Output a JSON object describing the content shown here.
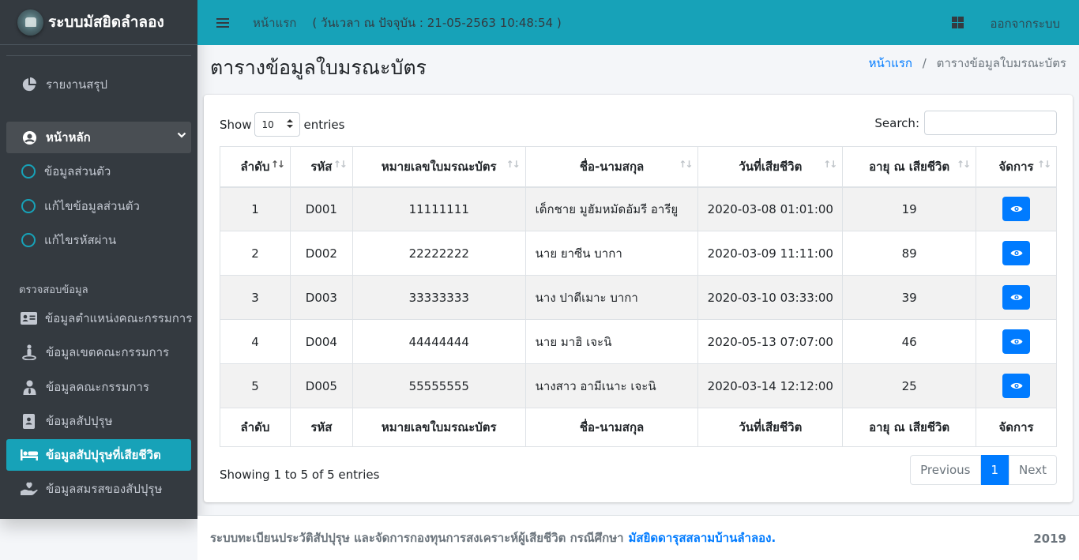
{
  "brand": {
    "name": "ระบบมัสยิดลำลอง",
    "logo_icon": "mosque-logo-icon"
  },
  "sidebar": {
    "report": "รายงานสรุป",
    "main_menu": "หน้าหลัก",
    "sub_items": [
      "ข้อมูลส่วนตัว",
      "แก้ไขข้อมูลส่วนตัว",
      "แก้ไขรหัสผ่าน"
    ],
    "section_header": "ตรวจสอบข้อมูล",
    "items": [
      {
        "label": "ข้อมูลตำแหน่งคณะกรรมการ",
        "icon": "id-card-icon"
      },
      {
        "label": "ข้อมูลเขตคณะกรรมการ",
        "icon": "street-view-icon"
      },
      {
        "label": "ข้อมูลคณะกรรมการ",
        "icon": "user-tie-icon"
      },
      {
        "label": "ข้อมูลสัปปุรุษ",
        "icon": "address-book-icon"
      },
      {
        "label": "ข้อมูลสัปปุรุษที่เสียชีวิต",
        "icon": "bed-icon",
        "active": true
      },
      {
        "label": "ข้อมูลสมรสของสัปปุรุษ",
        "icon": "hand-holding-heart-icon"
      }
    ]
  },
  "topbar": {
    "home": "หน้าแรก",
    "time": "( วันเวลา ณ ปัจจุบัน : 21-05-2563 10:48:54 )",
    "logout": "ออกจากระบบ"
  },
  "page": {
    "title": "ตารางข้อมูลใบมรณะบัตร",
    "breadcrumb_home": "หน้าแรก",
    "breadcrumb_current": "ตารางข้อมูลใบมรณะบัตร"
  },
  "table": {
    "show_label": "Show",
    "entries_label": "entries",
    "length_value": "10",
    "search_label": "Search:",
    "search_value": "",
    "headers": [
      "ลำดับ",
      "รหัส",
      "หมายเลขใบมรณะบัตร",
      "ชื่อ-นามสกุล",
      "วันที่เสียชีวิต",
      "อายุ ณ เสียชีวิต",
      "จัดการ"
    ],
    "rows": [
      [
        "1",
        "D001",
        "11111111",
        "เด็กชาย มูฮัมหมัดอัมรี อารียู",
        "2020-03-08 01:01:00",
        "19"
      ],
      [
        "2",
        "D002",
        "22222222",
        "นาย ยาซีน บากา",
        "2020-03-09 11:11:00",
        "89"
      ],
      [
        "3",
        "D003",
        "33333333",
        "นาง ปาตีเมาะ บากา",
        "2020-03-10 03:33:00",
        "39"
      ],
      [
        "4",
        "D004",
        "44444444",
        "นาย มาฮิ เจะนิ",
        "2020-05-13 07:07:00",
        "46"
      ],
      [
        "5",
        "D005",
        "55555555",
        "นางสาว อามีเนาะ เจะนิ",
        "2020-03-14 12:12:00",
        "25"
      ]
    ],
    "info": "Showing 1 to 5 of 5 entries",
    "pager": {
      "previous": "Previous",
      "current": "1",
      "next": "Next"
    }
  },
  "footer": {
    "text": "ระบบทะเบียนประวัติสัปปุรุษ และจัดการกองทุนการสงเคราะห์ผู้เสียชีวิต กรณีศึกษา",
    "link": "มัสยิดดารุสสลามบ้านลำลอง.",
    "year": "2019"
  },
  "colors": {
    "primary": "#007bff",
    "info": "#17a2b8",
    "sidebar": "#343a40"
  }
}
